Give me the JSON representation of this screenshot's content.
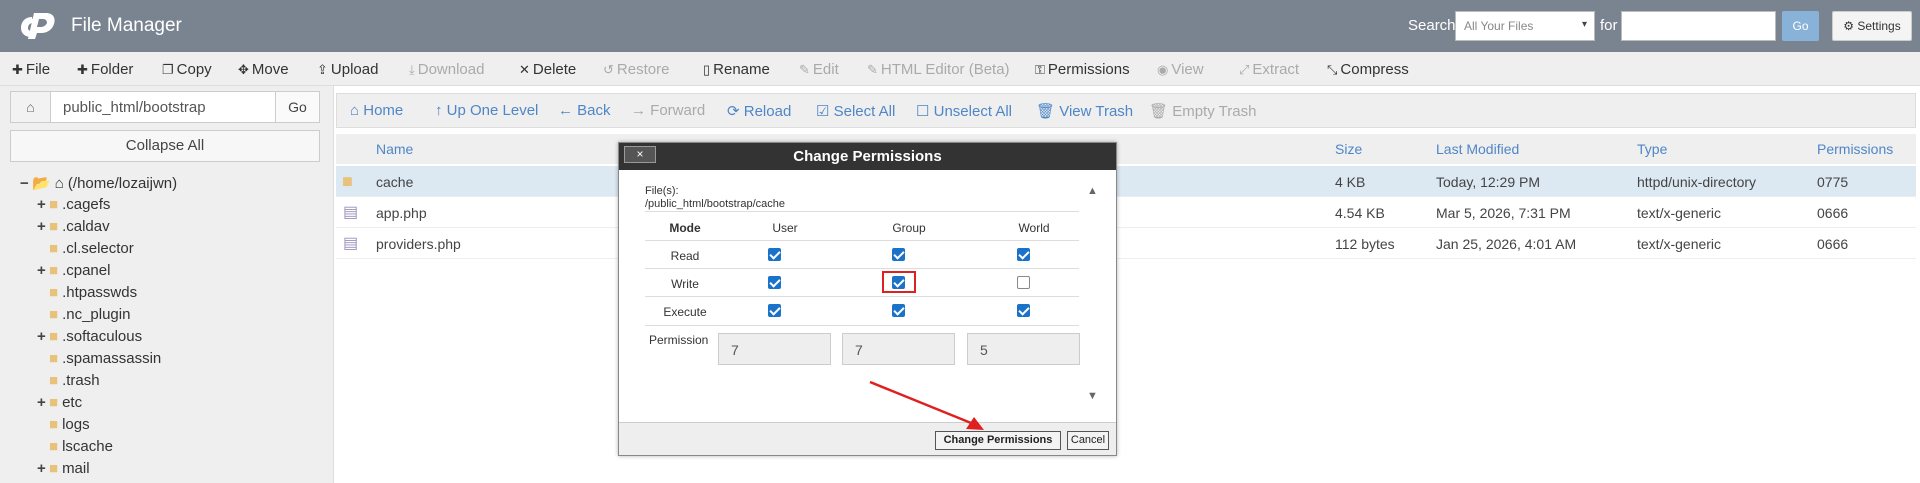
{
  "header": {
    "title": "File Manager",
    "search_label": "Search",
    "search_scope": "All Your Files",
    "for_label": "for",
    "search_value": "",
    "go_label": "Go",
    "settings_label": "Settings"
  },
  "toolbar": {
    "items": [
      {
        "label": "File",
        "icon": "plus-icon",
        "disabled": false
      },
      {
        "label": "Folder",
        "icon": "plus-icon",
        "disabled": false
      },
      {
        "label": "Copy",
        "icon": "copy-icon",
        "disabled": false
      },
      {
        "label": "Move",
        "icon": "move-icon",
        "disabled": false
      },
      {
        "label": "Upload",
        "icon": "upload-icon",
        "disabled": false
      },
      {
        "label": "Download",
        "icon": "download-icon",
        "disabled": true
      },
      {
        "label": "Delete",
        "icon": "close-icon",
        "disabled": false
      },
      {
        "label": "Restore",
        "icon": "restore-icon",
        "disabled": true
      },
      {
        "label": "Rename",
        "icon": "file-icon",
        "disabled": false
      },
      {
        "label": "Edit",
        "icon": "pencil-icon",
        "disabled": true
      },
      {
        "label": "HTML Editor (Beta)",
        "icon": "edit-icon",
        "disabled": true
      },
      {
        "label": "Permissions",
        "icon": "key-icon",
        "disabled": false
      },
      {
        "label": "View",
        "icon": "eye-icon",
        "disabled": true
      },
      {
        "label": "Extract",
        "icon": "expand-icon",
        "disabled": true
      },
      {
        "label": "Compress",
        "icon": "compress-icon",
        "disabled": false
      }
    ]
  },
  "sidebar": {
    "path": "public_html/bootstrap",
    "go_label": "Go",
    "collapse_label": "Collapse All",
    "tree": [
      {
        "label": "(/home/lozaijwn)",
        "toggle": "−",
        "root": true
      },
      {
        "label": ".cagefs",
        "toggle": "+"
      },
      {
        "label": ".caldav",
        "toggle": "+"
      },
      {
        "label": ".cl.selector",
        "toggle": ""
      },
      {
        "label": ".cpanel",
        "toggle": "+"
      },
      {
        "label": ".htpasswds",
        "toggle": ""
      },
      {
        "label": ".nc_plugin",
        "toggle": ""
      },
      {
        "label": ".softaculous",
        "toggle": "+"
      },
      {
        "label": ".spamassassin",
        "toggle": ""
      },
      {
        "label": ".trash",
        "toggle": ""
      },
      {
        "label": "etc",
        "toggle": "+"
      },
      {
        "label": "logs",
        "toggle": ""
      },
      {
        "label": "lscache",
        "toggle": ""
      },
      {
        "label": "mail",
        "toggle": "+"
      }
    ]
  },
  "nav": {
    "items": [
      {
        "label": "Home",
        "disabled": false
      },
      {
        "label": "Up One Level",
        "disabled": false
      },
      {
        "label": "Back",
        "disabled": false
      },
      {
        "label": "Forward",
        "disabled": true
      },
      {
        "label": "Reload",
        "disabled": false
      },
      {
        "label": "Select All",
        "disabled": false
      },
      {
        "label": "Unselect All",
        "disabled": false
      },
      {
        "label": "View Trash",
        "disabled": false
      },
      {
        "label": "Empty Trash",
        "disabled": true
      }
    ]
  },
  "table": {
    "columns": [
      "Name",
      "Size",
      "Last Modified",
      "Type",
      "Permissions"
    ],
    "rows": [
      {
        "name": "cache",
        "size": "4 KB",
        "modified": "Today, 12:29 PM",
        "type": "httpd/unix-directory",
        "perms": "0775",
        "kind": "folder",
        "selected": true
      },
      {
        "name": "app.php",
        "size": "4.54 KB",
        "modified": "Mar 5, 2026, 7:31 PM",
        "type": "text/x-generic",
        "perms": "0666",
        "kind": "file",
        "selected": false
      },
      {
        "name": "providers.php",
        "size": "112 bytes",
        "modified": "Jan 25, 2026, 4:01 AM",
        "type": "text/x-generic",
        "perms": "0666",
        "kind": "file",
        "selected": false
      }
    ]
  },
  "dialog": {
    "title": "Change Permissions",
    "close_label": "×",
    "files_label": "File(s):",
    "files_path": "/public_html/bootstrap/cache",
    "mode_label": "Mode",
    "columns": [
      "User",
      "Group",
      "World"
    ],
    "rows": [
      {
        "label": "Read",
        "values": [
          true,
          true,
          true
        ]
      },
      {
        "label": "Write",
        "values": [
          true,
          true,
          false
        ]
      },
      {
        "label": "Execute",
        "values": [
          true,
          true,
          true
        ]
      }
    ],
    "permission_label": "Permission",
    "permission_values": [
      "7",
      "7",
      "5"
    ],
    "submit_label": "Change Permissions",
    "cancel_label": "Cancel"
  },
  "colors": {
    "header_bg": "#7a8390",
    "link": "#4f86c6",
    "dialog_title_bg": "#333333",
    "highlight": "#e02020",
    "checkbox_on": "#1a73c8"
  }
}
